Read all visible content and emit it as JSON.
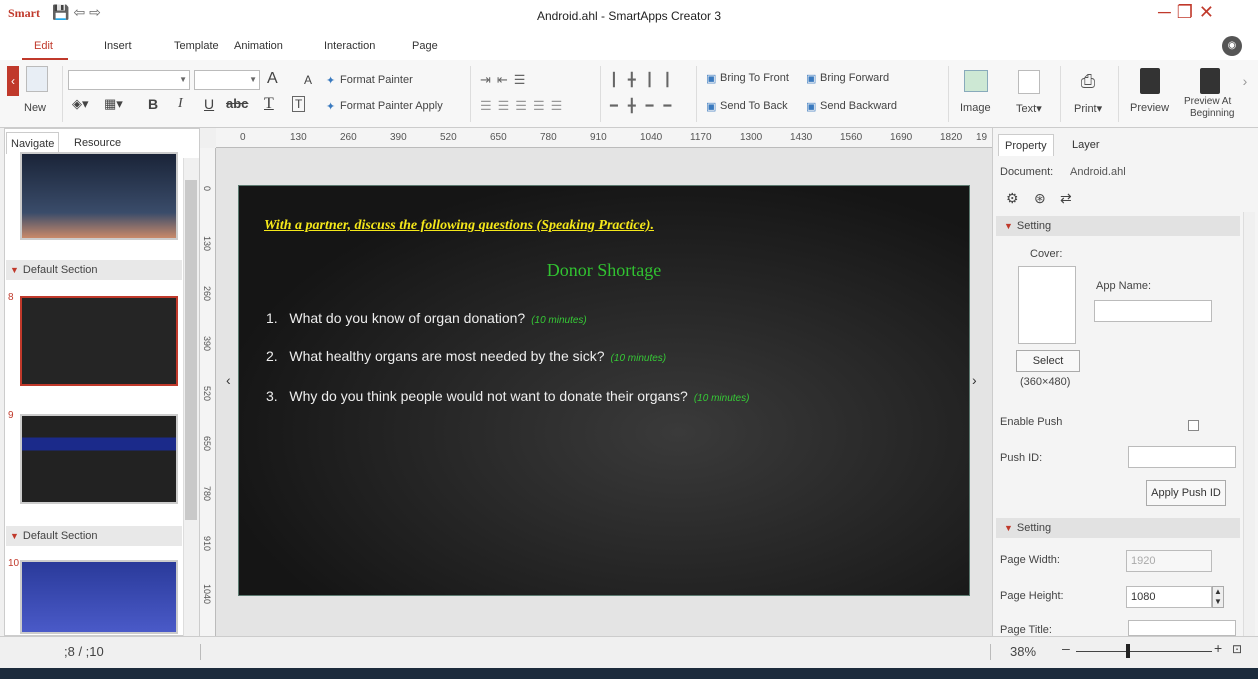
{
  "app": {
    "logo": "Smart",
    "title": "Android.ahl - SmartApps Creator 3",
    "quick_access": [
      "save-icon",
      "undo-icon",
      "redo-icon"
    ]
  },
  "menu": [
    "Edit",
    "Insert",
    "Template",
    "Animation",
    "Interaction",
    "Page"
  ],
  "ribbon": {
    "new": "New",
    "format_painter": "Format Painter",
    "format_painter_apply": "Format Painter Apply",
    "bring_to_front": "Bring To Front",
    "bring_forward": "Bring Forward",
    "send_to_back": "Send To Back",
    "send_backward": "Send Backward",
    "image": "Image",
    "text": "Text",
    "print": "Print",
    "preview": "Preview",
    "preview_at_beginning_1": "Preview At",
    "preview_at_beginning_2": "Beginning",
    "font_size_up": "A",
    "font_size_down": "A",
    "bold": "B",
    "italic": "I",
    "underline": "U",
    "strike": "abc",
    "font_color": "T"
  },
  "left_panel": {
    "tabs": [
      "Navigate",
      "Resource"
    ],
    "sections": [
      "Default Section",
      "Default Section"
    ],
    "pages": [
      "8",
      "9",
      "10"
    ]
  },
  "rulers": {
    "h": [
      "0",
      "130",
      "260",
      "390",
      "520",
      "650",
      "780",
      "910",
      "1040",
      "1170",
      "1300",
      "1430",
      "1560",
      "1690",
      "1820",
      "19"
    ],
    "v": [
      "0",
      "130",
      "260",
      "390",
      "520",
      "650",
      "780",
      "910",
      "1040"
    ]
  },
  "slide": {
    "heading": "With a partner, discuss the following questions (Speaking Practice).",
    "title": "Donor Shortage",
    "questions": [
      {
        "num": "1.",
        "text": "What do you know of organ donation?",
        "note": "(10 minutes)"
      },
      {
        "num": "2.",
        "text": "What healthy organs are most needed by the sick?",
        "note": "(10 minutes)"
      },
      {
        "num": "3.",
        "text": "Why do you think people would not want to donate their organs?",
        "note": "(10 minutes)"
      }
    ]
  },
  "right_panel": {
    "tabs": [
      "Property",
      "Layer"
    ],
    "document_label": "Document:",
    "document_value": "Android.ahl",
    "setting1": "Setting",
    "cover_label": "Cover:",
    "app_name_label": "App Name:",
    "select_button": "Select",
    "cover_size": "(360×480)",
    "enable_push": "Enable Push",
    "push_id": "Push ID:",
    "apply_push_id": "Apply Push ID",
    "setting2": "Setting",
    "page_width_label": "Page Width:",
    "page_width_value": "1920",
    "page_height_label": "Page Height:",
    "page_height_value": "1080",
    "page_title_label": "Page Title:"
  },
  "status": {
    "page_indicator": ";8 / ;10",
    "zoom": "38%",
    "zoom_fraction": 0.38
  },
  "colors": {
    "accent": "#c0392b",
    "slide_heading": "#f5e81a",
    "slide_title": "#31c231"
  }
}
